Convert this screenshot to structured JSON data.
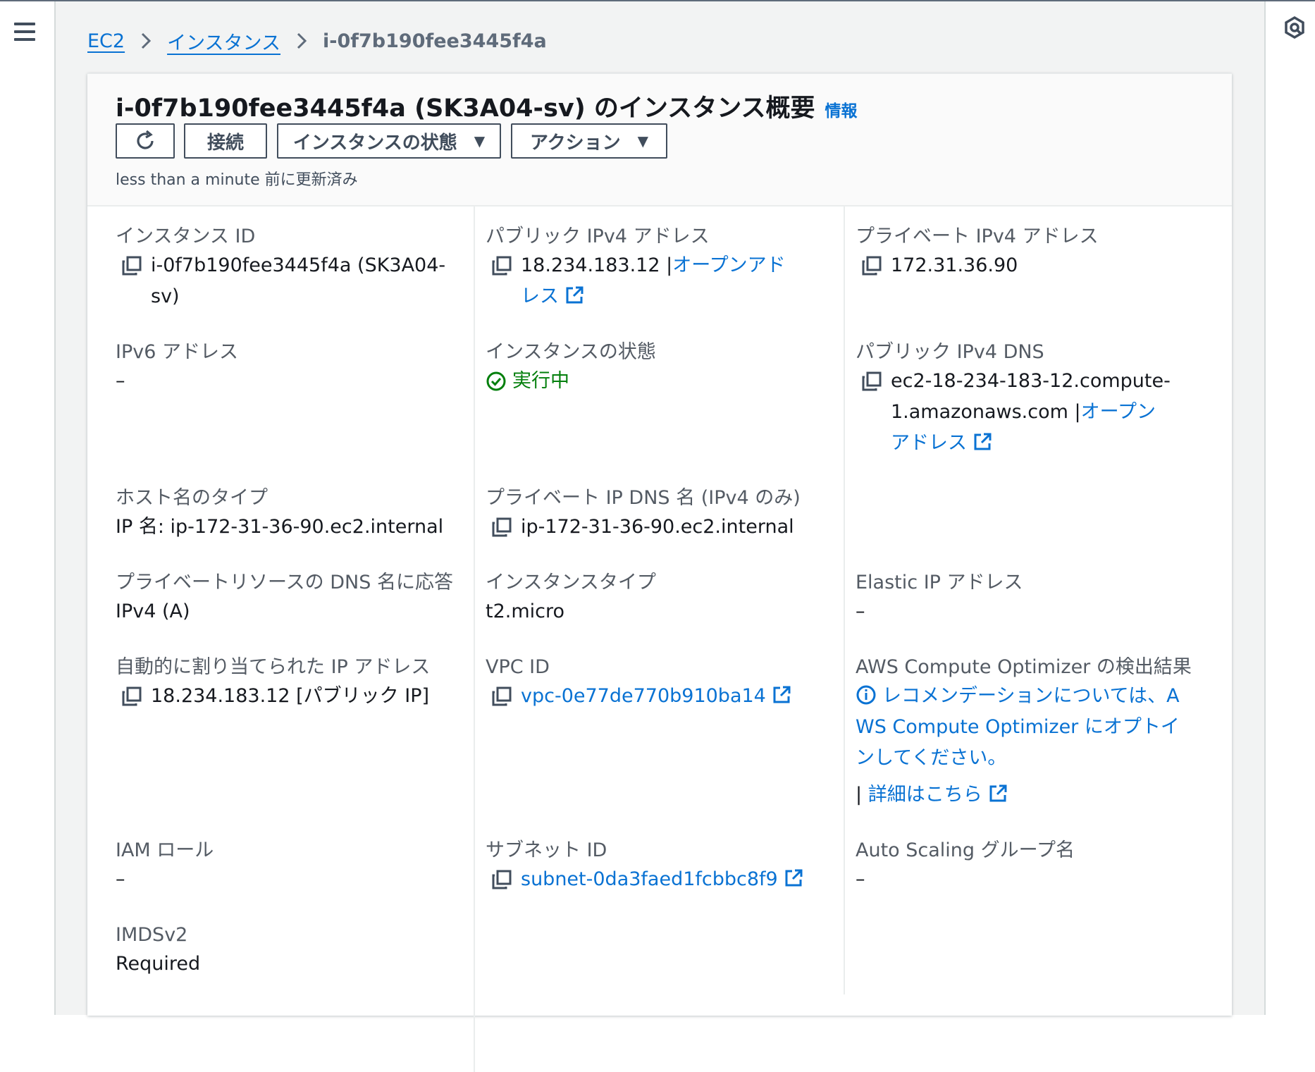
{
  "breadcrumb": {
    "ec2": "EC2",
    "instances": "インスタンス",
    "current": "i-0f7b190fee3445f4a"
  },
  "header": {
    "title": "i-0f7b190fee3445f4a (SK3A04-sv) のインスタンス概要",
    "info": "情報",
    "connect": "接続",
    "instance_state": "インスタンスの状態",
    "actions": "アクション",
    "updated": "less than a minute 前に更新済み"
  },
  "fields": {
    "instance_id": {
      "label": "インスタンス ID",
      "value": "i-0f7b190fee3445f4a (SK3A04-sv)"
    },
    "public_ipv4": {
      "label": "パブリック IPv4 アドレス",
      "value": "18.234.183.12",
      "sep": "|",
      "link": "オープンアドレス"
    },
    "private_ipv4": {
      "label": "プライベート IPv4 アドレス",
      "value": "172.31.36.90"
    },
    "ipv6": {
      "label": "IPv6 アドレス",
      "value": "–"
    },
    "instance_state": {
      "label": "インスタンスの状態",
      "value": "実行中"
    },
    "public_dns": {
      "label": "パブリック IPv4 DNS",
      "value": "ec2-18-234-183-12.compute-1.amazonaws.com",
      "sep": "|",
      "link": "オープンアドレス"
    },
    "hostname_type": {
      "label": "ホスト名のタイプ",
      "value": "IP 名: ip-172-31-36-90.ec2.internal"
    },
    "private_ip_dns": {
      "label": "プライベート IP DNS 名 (IPv4 のみ)",
      "value": "ip-172-31-36-90.ec2.internal"
    },
    "private_resource_dns": {
      "label": "プライベートリソースの DNS 名に応答",
      "value": "IPv4 (A)"
    },
    "instance_type": {
      "label": "インスタンスタイプ",
      "value": "t2.micro"
    },
    "elastic_ip": {
      "label": "Elastic IP アドレス",
      "value": "–"
    },
    "auto_ip": {
      "label": "自動的に割り当てられた IP アドレス",
      "value": "18.234.183.12 [パブリック IP]"
    },
    "vpc_id": {
      "label": "VPC ID",
      "value": "vpc-0e77de770b910ba14"
    },
    "compute_optimizer": {
      "label": "AWS Compute Optimizer の検出結果",
      "value": "レコメンデーションについては、AWS Compute Optimizer にオプトインしてください。",
      "sep": "|",
      "link": "詳細はこちら"
    },
    "iam_role": {
      "label": "IAM ロール",
      "value": "–"
    },
    "subnet_id": {
      "label": "サブネット ID",
      "value": "subnet-0da3faed1fcbbc8f9"
    },
    "asg_name": {
      "label": "Auto Scaling グループ名",
      "value": "–"
    },
    "imdsv2": {
      "label": "IMDSv2",
      "value": "Required"
    }
  },
  "icons": {
    "menu": "menu-icon",
    "right_rail": "notifications-icon",
    "copy": "copy-icon",
    "external": "external-link-icon",
    "refresh": "refresh-icon",
    "status": "check-circle-icon",
    "info": "info-icon"
  },
  "colors": {
    "link": "#0972d3",
    "success": "#037f0c",
    "text": "#16191f",
    "label": "#545b64",
    "page_bg": "#f2f3f3"
  }
}
